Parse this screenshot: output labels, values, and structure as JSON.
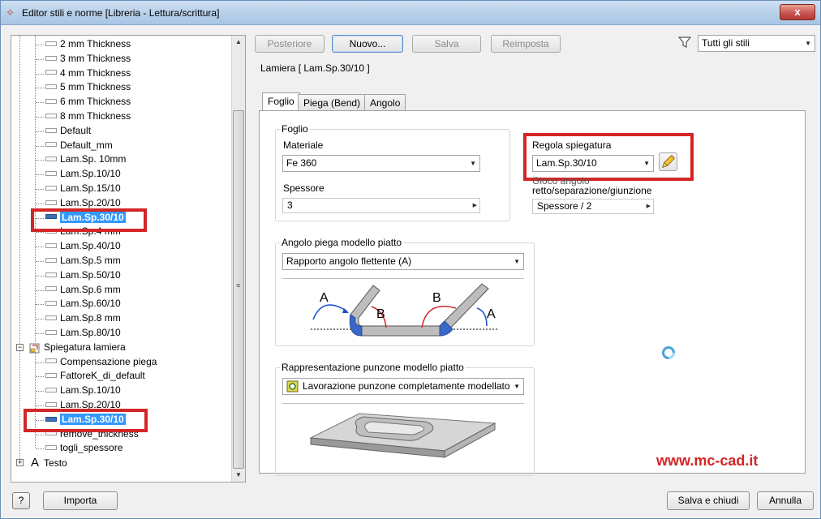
{
  "window": {
    "title": "Editor stili e norme [Libreria - Lettura/scrittura]",
    "close_glyph": "x"
  },
  "tree": {
    "top_items": [
      {
        "label": "2 mm Thickness",
        "selected": false
      },
      {
        "label": "3 mm Thickness",
        "selected": false
      },
      {
        "label": "4 mm Thickness",
        "selected": false
      },
      {
        "label": "5 mm Thickness",
        "selected": false
      },
      {
        "label": "6 mm Thickness",
        "selected": false
      },
      {
        "label": "8 mm Thickness",
        "selected": false
      },
      {
        "label": "Default",
        "selected": false
      },
      {
        "label": "Default_mm",
        "selected": false
      },
      {
        "label": "Lam.Sp. 10mm",
        "selected": false
      },
      {
        "label": "Lam.Sp.10/10",
        "selected": false
      },
      {
        "label": "Lam.Sp.15/10",
        "selected": false
      },
      {
        "label": "Lam.Sp.20/10",
        "selected": false
      },
      {
        "label": "Lam.Sp.30/10",
        "selected": true
      },
      {
        "label": "Lam.Sp.4 mm",
        "selected": false
      },
      {
        "label": "Lam.Sp.40/10",
        "selected": false
      },
      {
        "label": "Lam.Sp.5 mm",
        "selected": false
      },
      {
        "label": "Lam.Sp.50/10",
        "selected": false
      },
      {
        "label": "Lam.Sp.6 mm",
        "selected": false
      },
      {
        "label": "Lam.Sp.60/10",
        "selected": false
      },
      {
        "label": "Lam.Sp.8 mm",
        "selected": false
      },
      {
        "label": "Lam.Sp.80/10",
        "selected": false
      }
    ],
    "group_label": "Spiegatura lamiera",
    "group_items": [
      {
        "label": "Compensazione piega",
        "selected": false
      },
      {
        "label": "FattoreK_di_default",
        "selected": false
      },
      {
        "label": "Lam.Sp.10/10",
        "selected": false
      },
      {
        "label": "Lam.Sp.20/10",
        "selected": false
      },
      {
        "label": "Lam.Sp.30/10",
        "selected": true
      },
      {
        "label": "remove_thickness",
        "selected": false
      },
      {
        "label": "togli_spessore",
        "selected": false
      }
    ],
    "text_node_icon": "A",
    "text_node_label": "Testo",
    "expand_glyph": "+",
    "collapse_glyph": "−"
  },
  "toolbar": {
    "back_label": "Posteriore",
    "new_label": "Nuovo...",
    "save_label": "Salva",
    "reset_label": "Reimposta",
    "filter_value": "Tutti gli stili"
  },
  "editor": {
    "style_title": "Lamiera [ Lam.Sp.30/10 ]",
    "tabs": [
      {
        "label": "Foglio",
        "active": true
      },
      {
        "label": "Piega (Bend)",
        "active": false
      },
      {
        "label": "Angolo",
        "active": false
      }
    ],
    "sheet": {
      "group_title": "Foglio",
      "material_label": "Materiale",
      "material_value": "Fe 360",
      "thickness_label": "Spessore",
      "thickness_value": "3"
    },
    "unfold": {
      "label": "Regola spiegatura",
      "value": "Lam.Sp.30/10",
      "gap_label_line1": "Gioco angolo",
      "gap_label_line2": "retto/separazione/giunzione",
      "gap_value": "Spessore / 2"
    },
    "flat_angle": {
      "group_title": "Angolo piega modello piatto",
      "value": "Rapporto angolo flettente (A)",
      "diagram_label_a": "A",
      "diagram_label_b": "B"
    },
    "punch": {
      "group_title": "Rappresentazione punzone modello piatto",
      "value": "Lavorazione punzone completamente modellato"
    },
    "watermark": "www.mc-cad.it"
  },
  "footer": {
    "help_label": "?",
    "import_label": "Importa",
    "save_close_label": "Salva e chiudi",
    "cancel_label": "Annulla"
  },
  "colors": {
    "highlight": "#d32626",
    "selection": "#3399ff"
  }
}
